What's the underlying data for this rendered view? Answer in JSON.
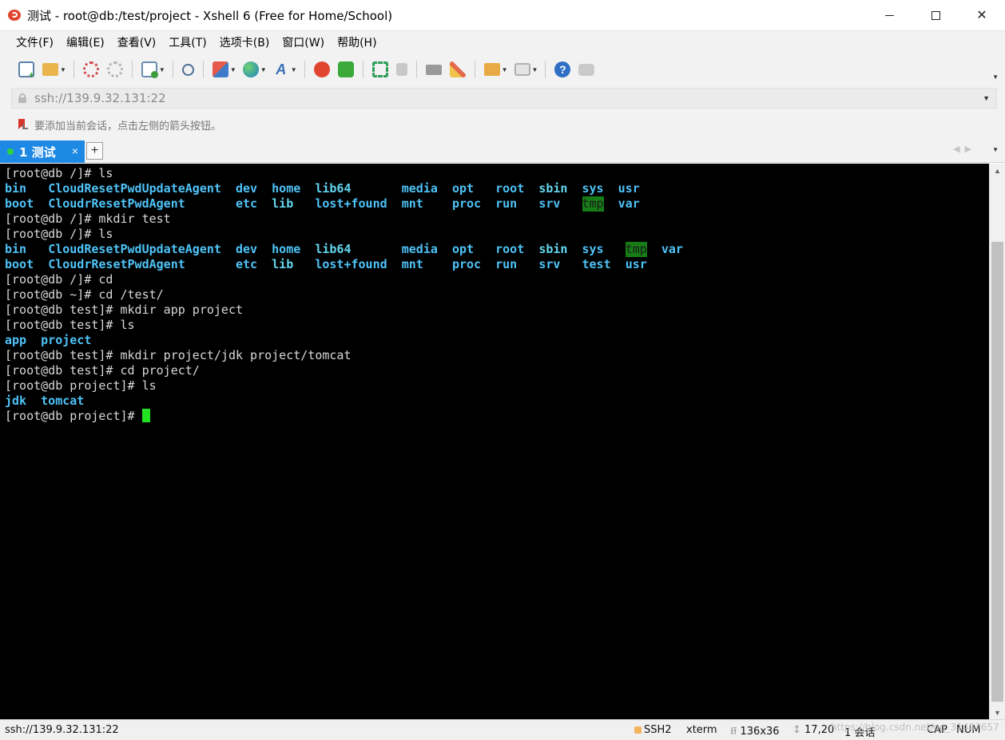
{
  "window": {
    "title": "测试 - root@db:/test/project - Xshell 6 (Free for Home/School)",
    "controls": {
      "minimize": "—",
      "maximize": "☐",
      "close": "✕"
    }
  },
  "menu": [
    "文件(F)",
    "编辑(E)",
    "查看(V)",
    "工具(T)",
    "选项卡(B)",
    "窗口(W)",
    "帮助(H)"
  ],
  "toolbar": {
    "icons": [
      "new-session-icon",
      "open-folder-icon",
      "connect-icon",
      "disconnect-icon",
      "session-properties-icon",
      "find-icon",
      "transfer-icon",
      "globe-icon",
      "font-icon",
      "xshell-icon",
      "xftp-icon",
      "fullscreen-icon",
      "lock-icon",
      "keyboard-icon",
      "highlight-icon",
      "add-tab-icon",
      "layout-icon",
      "help-icon",
      "chat-icon"
    ]
  },
  "address": {
    "value": "ssh://139.9.32.131:22"
  },
  "hint": {
    "text": "要添加当前会话，点击左侧的箭头按钮。"
  },
  "tabs": [
    {
      "label": "1 测试",
      "close": "×"
    }
  ],
  "tab_add": "+",
  "terminal": {
    "lines": [
      {
        "segments": [
          {
            "text": "[root@db /]# ls",
            "style": "normal"
          }
        ]
      },
      {
        "segments": [
          {
            "text": "bin   ",
            "style": "dir"
          },
          {
            "text": "CloudResetPwdUpdateAgent",
            "style": "dir"
          },
          {
            "text": "  ",
            "style": "normal"
          },
          {
            "text": "dev",
            "style": "dir"
          },
          {
            "text": "  ",
            "style": "normal"
          },
          {
            "text": "home",
            "style": "dir"
          },
          {
            "text": "  ",
            "style": "normal"
          },
          {
            "text": "lib64",
            "style": "cyan"
          },
          {
            "text": "       ",
            "style": "normal"
          },
          {
            "text": "media",
            "style": "dir"
          },
          {
            "text": "  ",
            "style": "normal"
          },
          {
            "text": "opt",
            "style": "dir"
          },
          {
            "text": "   ",
            "style": "normal"
          },
          {
            "text": "root",
            "style": "dir"
          },
          {
            "text": "  ",
            "style": "normal"
          },
          {
            "text": "sbin",
            "style": "cyan"
          },
          {
            "text": "  ",
            "style": "normal"
          },
          {
            "text": "sys",
            "style": "dir"
          },
          {
            "text": "  ",
            "style": "normal"
          },
          {
            "text": "usr",
            "style": "dir"
          }
        ]
      },
      {
        "segments": [
          {
            "text": "boot  ",
            "style": "dir"
          },
          {
            "text": "CloudrResetPwdAgent",
            "style": "dir"
          },
          {
            "text": "       ",
            "style": "normal"
          },
          {
            "text": "etc",
            "style": "dir"
          },
          {
            "text": "  ",
            "style": "normal"
          },
          {
            "text": "lib",
            "style": "cyan"
          },
          {
            "text": "   ",
            "style": "normal"
          },
          {
            "text": "lost+found",
            "style": "dir"
          },
          {
            "text": "  ",
            "style": "normal"
          },
          {
            "text": "mnt",
            "style": "dir"
          },
          {
            "text": "    ",
            "style": "normal"
          },
          {
            "text": "proc",
            "style": "dir"
          },
          {
            "text": "  ",
            "style": "normal"
          },
          {
            "text": "run",
            "style": "dir"
          },
          {
            "text": "   ",
            "style": "normal"
          },
          {
            "text": "srv",
            "style": "dir"
          },
          {
            "text": "   ",
            "style": "normal"
          },
          {
            "text": "tmp",
            "style": "tmp"
          },
          {
            "text": "  ",
            "style": "normal"
          },
          {
            "text": "var",
            "style": "dir"
          }
        ]
      },
      {
        "segments": [
          {
            "text": "[root@db /]# mkdir test",
            "style": "normal"
          }
        ]
      },
      {
        "segments": [
          {
            "text": "[root@db /]# ls",
            "style": "normal"
          }
        ]
      },
      {
        "segments": [
          {
            "text": "bin   ",
            "style": "dir"
          },
          {
            "text": "CloudResetPwdUpdateAgent",
            "style": "dir"
          },
          {
            "text": "  ",
            "style": "normal"
          },
          {
            "text": "dev",
            "style": "dir"
          },
          {
            "text": "  ",
            "style": "normal"
          },
          {
            "text": "home",
            "style": "dir"
          },
          {
            "text": "  ",
            "style": "normal"
          },
          {
            "text": "lib64",
            "style": "cyan"
          },
          {
            "text": "       ",
            "style": "normal"
          },
          {
            "text": "media",
            "style": "dir"
          },
          {
            "text": "  ",
            "style": "normal"
          },
          {
            "text": "opt",
            "style": "dir"
          },
          {
            "text": "   ",
            "style": "normal"
          },
          {
            "text": "root",
            "style": "dir"
          },
          {
            "text": "  ",
            "style": "normal"
          },
          {
            "text": "sbin",
            "style": "cyan"
          },
          {
            "text": "  ",
            "style": "normal"
          },
          {
            "text": "sys",
            "style": "dir"
          },
          {
            "text": "   ",
            "style": "normal"
          },
          {
            "text": "tmp",
            "style": "tmp"
          },
          {
            "text": "  ",
            "style": "normal"
          },
          {
            "text": "var",
            "style": "dir"
          }
        ]
      },
      {
        "segments": [
          {
            "text": "boot  ",
            "style": "dir"
          },
          {
            "text": "CloudrResetPwdAgent",
            "style": "dir"
          },
          {
            "text": "       ",
            "style": "normal"
          },
          {
            "text": "etc",
            "style": "dir"
          },
          {
            "text": "  ",
            "style": "normal"
          },
          {
            "text": "lib",
            "style": "cyan"
          },
          {
            "text": "   ",
            "style": "normal"
          },
          {
            "text": "lost+found",
            "style": "dir"
          },
          {
            "text": "  ",
            "style": "normal"
          },
          {
            "text": "mnt",
            "style": "dir"
          },
          {
            "text": "    ",
            "style": "normal"
          },
          {
            "text": "proc",
            "style": "dir"
          },
          {
            "text": "  ",
            "style": "normal"
          },
          {
            "text": "run",
            "style": "dir"
          },
          {
            "text": "   ",
            "style": "normal"
          },
          {
            "text": "srv",
            "style": "dir"
          },
          {
            "text": "   ",
            "style": "normal"
          },
          {
            "text": "test",
            "style": "dir"
          },
          {
            "text": "  ",
            "style": "normal"
          },
          {
            "text": "usr",
            "style": "dir"
          }
        ]
      },
      {
        "segments": [
          {
            "text": "[root@db /]# cd",
            "style": "normal"
          }
        ]
      },
      {
        "segments": [
          {
            "text": "[root@db ~]# cd /test/",
            "style": "normal"
          }
        ]
      },
      {
        "segments": [
          {
            "text": "[root@db test]# mkdir app project",
            "style": "normal"
          }
        ]
      },
      {
        "segments": [
          {
            "text": "[root@db test]# ls",
            "style": "normal"
          }
        ]
      },
      {
        "segments": [
          {
            "text": "app",
            "style": "dir"
          },
          {
            "text": "  ",
            "style": "normal"
          },
          {
            "text": "project",
            "style": "dir"
          }
        ]
      },
      {
        "segments": [
          {
            "text": "[root@db test]# mkdir project/jdk project/tomcat",
            "style": "normal"
          }
        ]
      },
      {
        "segments": [
          {
            "text": "[root@db test]# cd project/",
            "style": "normal"
          }
        ]
      },
      {
        "segments": [
          {
            "text": "[root@db project]# ls",
            "style": "normal"
          }
        ]
      },
      {
        "segments": [
          {
            "text": "jdk",
            "style": "dir"
          },
          {
            "text": "  ",
            "style": "normal"
          },
          {
            "text": "tomcat",
            "style": "dir"
          }
        ]
      },
      {
        "segments": [
          {
            "text": "[root@db project]# ",
            "style": "normal"
          }
        ],
        "cursor": true
      }
    ]
  },
  "status": {
    "connection": "ssh://139.9.32.131:22",
    "protocol": "SSH2",
    "terminal_type": "xterm",
    "size": "136x36",
    "position": "17,20",
    "sessions": "1 会话",
    "cap": "CAP",
    "num": "NUM",
    "watermark": "https://blog.csdn.net/qq_31487657"
  },
  "colors": {
    "tab_active": "#1e88e5",
    "terminal_bg": "#000000",
    "dir_blue": "#4fc3f7",
    "tmp_bg": "#167d16",
    "cursor": "#22e322"
  }
}
